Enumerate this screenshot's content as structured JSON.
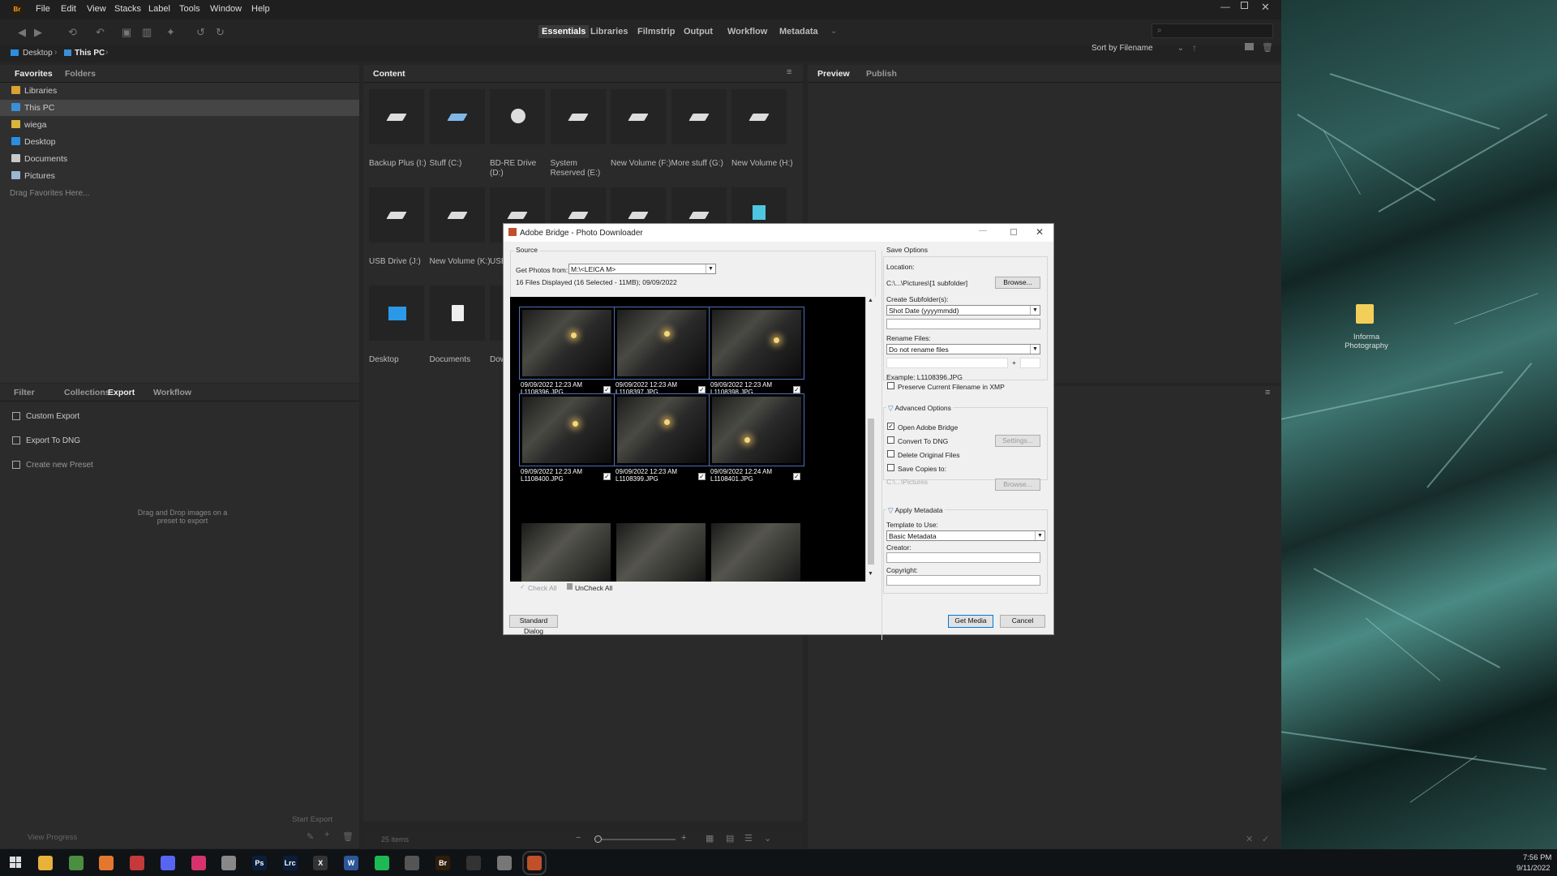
{
  "app": {
    "logo": "Br",
    "menus": [
      "File",
      "Edit",
      "View",
      "Stacks",
      "Label",
      "Tools",
      "Window",
      "Help"
    ],
    "workspaces": [
      "Essentials",
      "Libraries",
      "Filmstrip",
      "Output",
      "Workflow",
      "Metadata"
    ],
    "active_workspace": "Essentials",
    "sort_label": "Sort by Filename",
    "search_placeholder": "",
    "path": [
      "Desktop",
      "This PC"
    ]
  },
  "favorites_panel": {
    "tabs": [
      "Favorites",
      "Folders"
    ],
    "items": [
      {
        "label": "Libraries",
        "icon": "libraries-icon",
        "color": "#d9a232"
      },
      {
        "label": "This PC",
        "icon": "computer-icon",
        "color": "#3b8fd6",
        "selected": true
      },
      {
        "label": "wiega",
        "icon": "folder-icon",
        "color": "#d9b43a"
      },
      {
        "label": "Desktop",
        "icon": "desktop-icon",
        "color": "#2a8fe0"
      },
      {
        "label": "Documents",
        "icon": "documents-icon",
        "color": "#c9c9c9"
      },
      {
        "label": "Pictures",
        "icon": "pictures-icon",
        "color": "#9cb7d4"
      }
    ],
    "drag_hint": "Drag Favorites Here..."
  },
  "content_panel": {
    "tab": "Content",
    "items": [
      {
        "name": "Backup Plus (I:)"
      },
      {
        "name": "Stuff (C:)"
      },
      {
        "name": "BD-RE Drive (D:)"
      },
      {
        "name": "System Reserved (E:)"
      },
      {
        "name": "New Volume (F:)"
      },
      {
        "name": "More stuff (G:)"
      },
      {
        "name": "New Volume (H:)"
      },
      {
        "name": "USB Drive (J:)"
      },
      {
        "name": "New Volume (K:)"
      },
      {
        "name": "USB"
      },
      {
        "name": ""
      },
      {
        "name": ""
      },
      {
        "name": ""
      },
      {
        "name": ""
      },
      {
        "name": "Desktop"
      },
      {
        "name": "Documents"
      },
      {
        "name": "Dow"
      }
    ],
    "status": "25 items"
  },
  "preview_panel": {
    "tabs": [
      "Preview",
      "Publish"
    ]
  },
  "export_panel": {
    "tabs": [
      "Filter",
      "Collections",
      "Export",
      "Workflow"
    ],
    "active_tab": "Export",
    "items": [
      "Custom Export",
      "Export To DNG",
      "Create new Preset"
    ],
    "hint": "Drag and Drop images on a preset to export",
    "start_export": "Start Export",
    "view_progress": "View Progress"
  },
  "dialog": {
    "title": "Adobe Bridge - Photo Downloader",
    "source_label": "Source",
    "get_photos_label": "Get Photos from:",
    "get_photos_value": "M:\\<LEICA M>",
    "files_info": "16 Files Displayed (16 Selected - 11MB); 09/09/2022",
    "photos": [
      {
        "date": "09/09/2022 12:23 AM",
        "file": "L1108396.JPG",
        "checked": true
      },
      {
        "date": "09/09/2022 12:23 AM",
        "file": "L1108397.JPG",
        "checked": true
      },
      {
        "date": "09/09/2022 12:23 AM",
        "file": "L1108398.JPG",
        "checked": true
      },
      {
        "date": "09/09/2022 12:23 AM",
        "file": "L1108400.JPG",
        "checked": true
      },
      {
        "date": "09/09/2022 12:23 AM",
        "file": "L1108399.JPG",
        "checked": true
      },
      {
        "date": "09/09/2022 12:24 AM",
        "file": "L1108401.JPG",
        "checked": true
      }
    ],
    "check_all": "Check All",
    "uncheck_all": "UnCheck All",
    "save_options_label": "Save Options",
    "location_label": "Location:",
    "location_value": "C:\\...\\Pictures\\[1 subfolder]",
    "browse": "Browse...",
    "create_subfolders_label": "Create Subfolder(s):",
    "create_subfolders_value": "Shot Date (yyyymmdd)",
    "rename_files_label": "Rename Files:",
    "rename_files_value": "Do not rename files",
    "plus": "+",
    "example": "Example: L1108396.JPG",
    "preserve_filename": "Preserve Current Filename in XMP",
    "advanced_options_label": "Advanced Options",
    "open_adobe_bridge": "Open Adobe Bridge",
    "open_adobe_bridge_checked": true,
    "convert_to_dng": "Convert To DNG",
    "settings": "Settings...",
    "delete_original": "Delete Original Files",
    "save_copies_to": "Save Copies to:",
    "copies_path": "C:\\...\\Pictures",
    "apply_metadata_label": "Apply Metadata",
    "template_label": "Template to Use:",
    "template_value": "Basic Metadata",
    "creator_label": "Creator:",
    "copyright_label": "Copyright:",
    "standard_dialog": "Standard Dialog",
    "get_media": "Get Media",
    "cancel": "Cancel"
  },
  "desktop": {
    "icon_label": "Informa Photography"
  },
  "taskbar": {
    "apps": [
      {
        "icon": "file-explorer-icon",
        "glyph": "",
        "color": "#e6b23a"
      },
      {
        "icon": "chrome-icon",
        "glyph": "",
        "color": "#4a8f3f"
      },
      {
        "icon": "firefox-icon",
        "glyph": "",
        "color": "#e4772f"
      },
      {
        "icon": "calendar-icon",
        "glyph": "",
        "color": "#c43a3a"
      },
      {
        "icon": "discord-icon",
        "glyph": "",
        "color": "#5865f2"
      },
      {
        "icon": "app-pink-icon",
        "glyph": "",
        "color": "#d6336c"
      },
      {
        "icon": "printer-icon",
        "glyph": "",
        "color": "#888888"
      },
      {
        "icon": "photoshop-icon",
        "glyph": "Ps",
        "color": "#0a1d3a"
      },
      {
        "icon": "lightroom-icon",
        "glyph": "Lrc",
        "color": "#0a1d3a"
      },
      {
        "icon": "app-x-icon",
        "glyph": "X",
        "color": "#333333"
      },
      {
        "icon": "word-icon",
        "glyph": "W",
        "color": "#2b579a"
      },
      {
        "icon": "spotify-icon",
        "glyph": "",
        "color": "#1db954"
      },
      {
        "icon": "settings-icon",
        "glyph": "",
        "color": "#555555"
      },
      {
        "icon": "bridge-icon",
        "glyph": "Br",
        "color": "#2d1d0a"
      },
      {
        "icon": "camera-icon",
        "glyph": "",
        "color": "#333333"
      },
      {
        "icon": "mouse-icon",
        "glyph": "",
        "color": "#777777"
      },
      {
        "icon": "photo-downloader-icon",
        "glyph": "",
        "color": "#c0502a"
      }
    ],
    "time": "7:56 PM",
    "date": "9/11/2022"
  }
}
